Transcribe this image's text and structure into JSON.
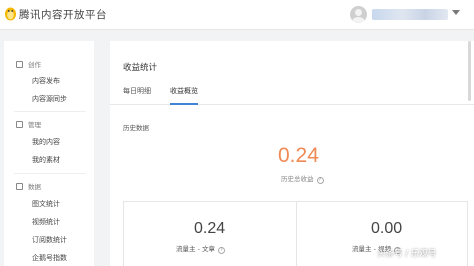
{
  "header": {
    "brand": "腾讯内容开放平台",
    "username_redacted": true
  },
  "sidebar": {
    "sections": [
      {
        "label": "创作",
        "items": [
          "内容发布",
          "内容源同步"
        ]
      },
      {
        "label": "管理",
        "items": [
          "我的内容",
          "我的素材"
        ]
      },
      {
        "label": "数据",
        "items": [
          "图文统计",
          "视频统计",
          "订阅数统计",
          "企鹅号指数"
        ]
      }
    ]
  },
  "main": {
    "title": "收益统计",
    "tabs": [
      {
        "label": "每日明细",
        "active": false
      },
      {
        "label": "收益概览",
        "active": true
      }
    ],
    "history_label": "历史数据",
    "total_value": "0.24",
    "total_label": "历史总收益",
    "stats": [
      {
        "value": "0.24",
        "label": "流量主 - 文章"
      },
      {
        "value": "0.00",
        "label": "流量主 - 视频"
      }
    ],
    "accent_color": "#f08a54",
    "tab_color": "#3e85d9"
  },
  "watermark": "头条号 / 乐观号"
}
